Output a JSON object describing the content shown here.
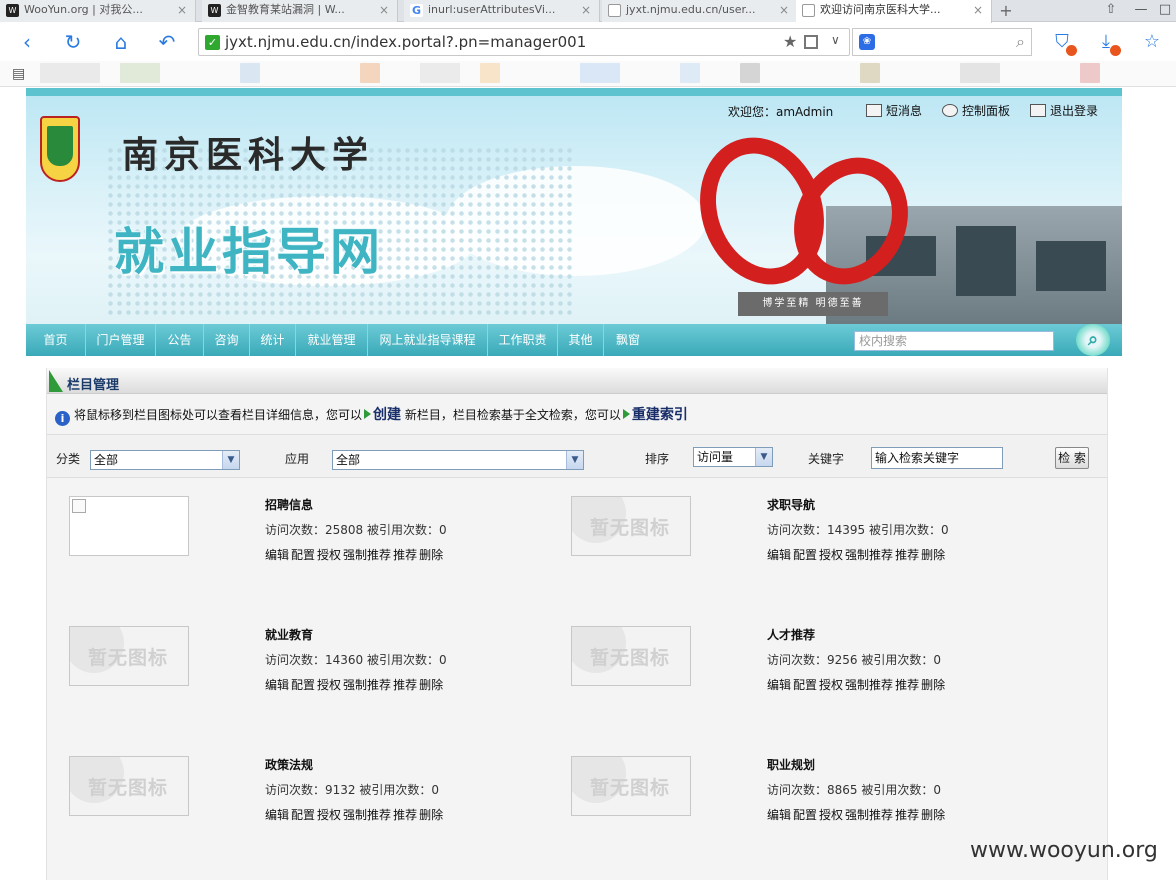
{
  "browser": {
    "tabs": [
      {
        "title": "WooYun.org | 对我公..."
      },
      {
        "title": "金智教育某站漏洞 | W..."
      },
      {
        "title": "inurl:userAttributesVi..."
      },
      {
        "title": "jyxt.njmu.edu.cn/user..."
      },
      {
        "title": "欢迎访问南京医科大学..."
      }
    ],
    "new_tab": "+",
    "url": "jyxt.njmu.edu.cn/index.portal?.pn=manager001"
  },
  "header": {
    "university": "南京医科大学",
    "site": "就业指导网",
    "pedestal": "博学至精 明德至善",
    "welcome": "欢迎您：amAdmin",
    "links": {
      "messages": "短消息",
      "control_panel": "控制面板",
      "logout": "退出登录"
    }
  },
  "nav": {
    "items": [
      "首页",
      "门户管理",
      "公告",
      "咨询",
      "统计",
      "就业管理",
      "网上就业指导课程",
      "工作职责",
      "其他",
      "飘窗"
    ],
    "search_placeholder": "校内搜索"
  },
  "panel": {
    "title": "栏目管理",
    "tip_pre": "将鼠标移到栏目图标处可以查看栏目详细信息，您可以",
    "tip_create": "创建",
    "tip_mid": "新栏目，栏目检索基于全文检索，您可以",
    "tip_reindex": "重建索引"
  },
  "filters": {
    "category_label": "分类",
    "category_value": "全部",
    "app_label": "应用",
    "app_value": "全部",
    "sort_label": "排序",
    "sort_value": "访问量",
    "keyword_label": "关键字",
    "keyword_value": "输入检索关键字",
    "search_button": "检 索"
  },
  "noicon_text": "暂无图标",
  "actions": [
    "编辑",
    "配置",
    "授权",
    "强制推荐",
    "推荐",
    "删除"
  ],
  "columns": [
    {
      "title": "招聘信息",
      "stats": "访问次数：25808 被引用次数：0",
      "has_icon": true
    },
    {
      "title": "求职导航",
      "stats": "访问次数：14395 被引用次数：0",
      "has_icon": false
    },
    {
      "title": "就业教育",
      "stats": "访问次数：14360 被引用次数：0",
      "has_icon": false
    },
    {
      "title": "人才推荐",
      "stats": "访问次数：9256 被引用次数：0",
      "has_icon": false
    },
    {
      "title": "政策法规",
      "stats": "访问次数：9132 被引用次数：0",
      "has_icon": false
    },
    {
      "title": "职业规划",
      "stats": "访问次数：8865 被引用次数：0",
      "has_icon": false
    }
  ],
  "watermark": "www.wooyun.org"
}
